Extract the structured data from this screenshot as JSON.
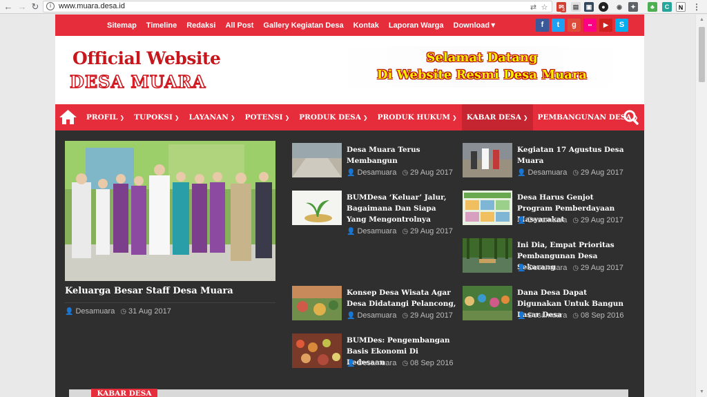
{
  "browser": {
    "url": "www.muara.desa.id",
    "ext_badge": "3"
  },
  "topbar": {
    "links": [
      "Sitemap",
      "Timeline",
      "Redaksi",
      "All Post",
      "Gallery Kegiatan Desa",
      "Kontak",
      "Laporan Warga",
      "Download"
    ],
    "social": [
      {
        "icon": "facebook-icon",
        "glyph": "f",
        "color": "#3b5998"
      },
      {
        "icon": "twitter-icon",
        "glyph": "t",
        "color": "#1da1f2"
      },
      {
        "icon": "google-plus-icon",
        "glyph": "g",
        "color": "#dd4b39"
      },
      {
        "icon": "flickr-icon",
        "glyph": "••",
        "color": "#ff0084"
      },
      {
        "icon": "youtube-icon",
        "glyph": "▶",
        "color": "#cd201f"
      },
      {
        "icon": "skype-icon",
        "glyph": "S",
        "color": "#00aff0"
      }
    ]
  },
  "header": {
    "logo_line1": "Official Website",
    "logo_line2": "DESA MUARA",
    "welcome_line1": "Selamat Datang",
    "welcome_line2": "Di Website Resmi Desa Muara"
  },
  "nav": {
    "items": [
      "PROFIL",
      "TUPOKSI",
      "LAYANAN",
      "POTENSI",
      "PRODUK DESA",
      "PRODUK HUKUM",
      "KABAR DESA",
      "PEMBANGUNAN DESA"
    ],
    "active": "KABAR DESA"
  },
  "featured": {
    "title": "Keluarga Besar Staff Desa Muara",
    "author": "Desamuara",
    "date": "31 Aug 2017"
  },
  "articles": [
    {
      "title": "Desa Muara Terus Membangun",
      "author": "Desamuara",
      "date": "29 Aug 2017"
    },
    {
      "title": "BUMDesa ‘Keluar’ Jalur, Bagaimana Dan Siapa Yang Mengontrolnya",
      "author": "Desamuara",
      "date": "29 Aug 2017"
    },
    {
      "title": "Konsep Desa Wisata Agar Desa Didatangi Pelancong,",
      "author": "Desamuara",
      "date": "29 Aug 2017"
    },
    {
      "title": "BUMDes: Pengembangan Basis Ekonomi Di Pedesaan",
      "author": "Desamuara",
      "date": "08 Sep 2016"
    },
    {
      "title": "Kegiatan 17 Agustus Desa Muara",
      "author": "Desamuara",
      "date": "29 Aug 2017"
    },
    {
      "title": "Desa Harus Genjot Program Pemberdayaan Masyarakat",
      "author": "Desamuara",
      "date": "29 Aug 2017"
    },
    {
      "title": "Ini Dia, Empat Prioritas Pembangunan Desa Sekarang",
      "author": "Desamuara",
      "date": "29 Aug 2017"
    },
    {
      "title": "Dana Desa Dapat Digunakan Untuk Bangun Pasar Desa",
      "author": "Desamuara",
      "date": "08 Sep 2016"
    }
  ],
  "section_label": "KABAR DESA"
}
